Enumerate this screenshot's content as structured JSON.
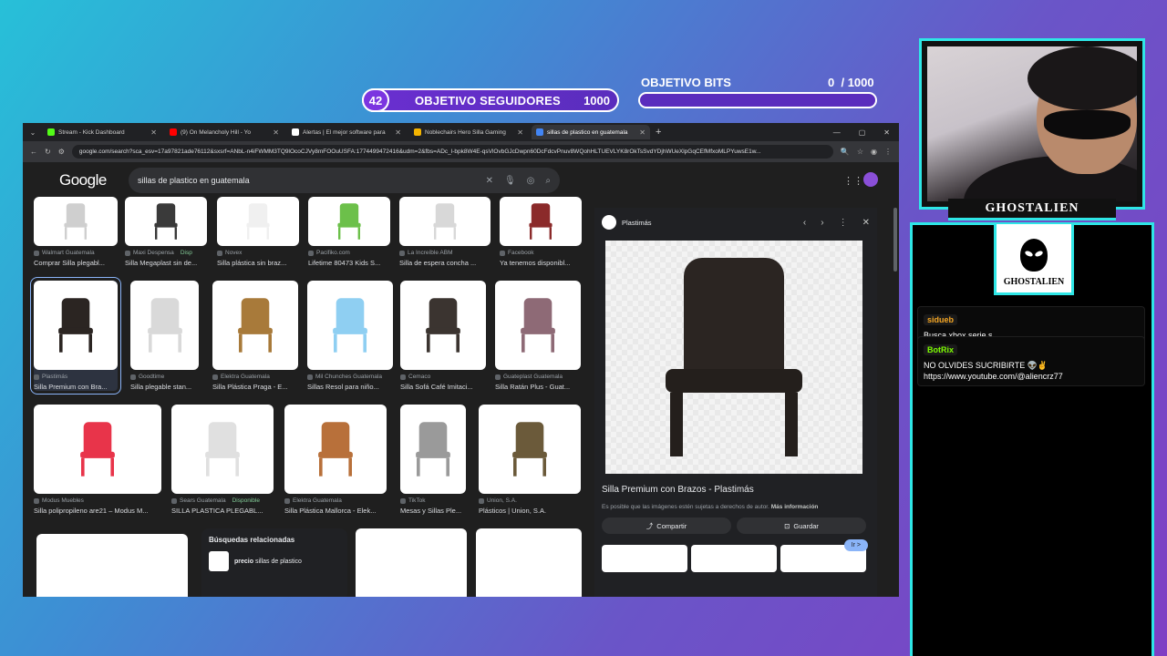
{
  "overlay": {
    "followers_goal": {
      "count": "42",
      "label": "OBJETIVO SEGUIDORES",
      "target": "1000"
    },
    "bits_goal": {
      "label": "OBJETIVO BITS",
      "current": "0",
      "target": "/ 1000",
      "progress": 0
    },
    "streamer_name": "GHOSTALIEN",
    "logo_name": "GHOSTALIEN"
  },
  "chat": {
    "messages": [
      {
        "user": "sidueb",
        "text": "Busca xbox serie s",
        "color": "#f5a623"
      },
      {
        "user": "BotRix",
        "text": "NO OLVIDES SUCRIBIRTE 👽✌️ https://www.youtube.com/@aliencrz77",
        "color": "#7CFC00"
      }
    ]
  },
  "browser": {
    "tabs": [
      {
        "title": "Stream - Kick Dashboard",
        "color": "#53fc18",
        "active": false
      },
      {
        "title": "(9) On Melancholy Hill - Yo",
        "color": "#ff0000",
        "active": false
      },
      {
        "title": "Alertas | El mejor software para",
        "color": "#ffffff",
        "active": false
      },
      {
        "title": "Noblechairs Hero Silla Gaming",
        "color": "#f4b400",
        "active": false
      },
      {
        "title": "sillas de plastico en guatemala",
        "color": "#4285f4",
        "active": true
      }
    ],
    "new_tab": "+",
    "url": "google.com/search?sca_esv=17a97821ade76112&sxsrf=ANbL-n4iFWMM3TQ9lOcoCJVy8mFOOuUSFA:1774499472416&udm=2&fbs=ADc_l-bpk8W4E-qsVlOvbGJcDwpn60DcFdcvPnuv8WQohHLTUEVLYK8rOkTsSvdYDjhWUeXlpGqCEfMfxoMLPYuwsE1w..."
  },
  "google": {
    "logo": "Google",
    "query": "sillas de plastico en guatemala",
    "results": [
      {
        "source": "Walmart Guatemala",
        "title": "Comprar Silla plegabl...",
        "color": "#cfcfcf"
      },
      {
        "source": "Maxi Despensa",
        "badge": "Disp",
        "title": "Silla Megaplast sin de...",
        "color": "#3a3a3a"
      },
      {
        "source": "Novex",
        "title": "Silla plástica sin braz...",
        "color": "#f0f0f0"
      },
      {
        "source": "Pacifiko.com",
        "title": "Lifetime 80473 Kids S...",
        "color": "#6cc04a"
      },
      {
        "source": "La Increíble ABM",
        "title": "Silla de espera concha ...",
        "color": "#d8d8d8"
      },
      {
        "source": "Facebook",
        "title": "Ya tenemos disponibl...",
        "color": "#8b2a2a"
      },
      {
        "source": "Plastimás",
        "title": "Silla Premium con Bra...",
        "color": "#2b2522"
      },
      {
        "source": "Goodtime",
        "title": "Silla plegable stan...",
        "color": "#d9d9d9"
      },
      {
        "source": "Elektra Guatemala",
        "title": "Silla Plástica Praga - E...",
        "color": "#a87a3a"
      },
      {
        "source": "Mil Chunches Guatemala",
        "title": "Sillas Resol para niño...",
        "color": "#8fcff2"
      },
      {
        "source": "Cemaco",
        "title": "Silla Sofá Café Imitaci...",
        "color": "#3b3430"
      },
      {
        "source": "Guateplast Guatemala",
        "title": "Silla Ratán Plus - Guat...",
        "color": "#8e6a76"
      },
      {
        "source": "Modus Muebles",
        "title": "Silla polipropileno are21 – Modus M...",
        "color": "#e8344a"
      },
      {
        "source": "Sears Guatemala",
        "badge": "Disponible",
        "title": "SILLA PLASTICA PLEGABL...",
        "color": "#e0e0e0"
      },
      {
        "source": "Elektra Guatemala",
        "title": "Silla Plástica Mallorca - Elek...",
        "color": "#b8703a"
      },
      {
        "source": "TikTok",
        "title": "Mesas y Sillas Ple...",
        "color": "#9a9a9a"
      },
      {
        "source": "Union, S.A.",
        "title": "Plásticos | Union, S.A.",
        "color": "#6b5a3a"
      }
    ],
    "related": {
      "heading": "Búsquedas relacionadas",
      "item_bold": "precio",
      "item_rest": " sillas de plastico"
    }
  },
  "preview": {
    "site": "Plastimás",
    "title": "Silla Premium con Brazos - Plastimás",
    "go": "Ir >",
    "note": "Es posible que las imágenes estén sujetas a derechos de autor.",
    "note_link": "Más información",
    "share": "Compartir",
    "save": "Guardar"
  }
}
